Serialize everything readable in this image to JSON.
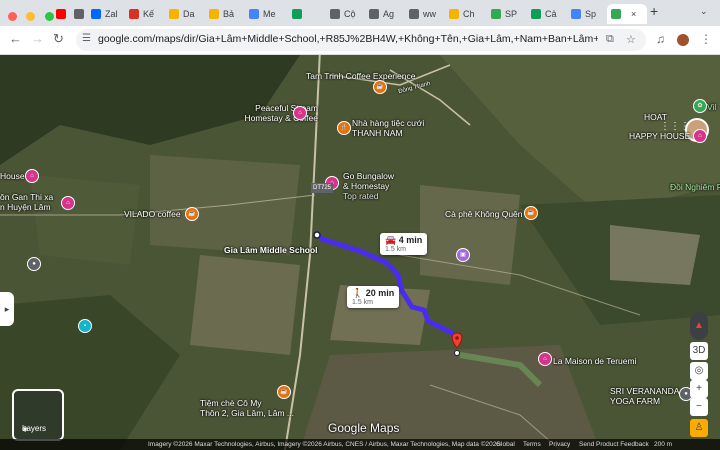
{
  "tabs": [
    {
      "label": "",
      "color": "#ff0000"
    },
    {
      "label": "",
      "color": "#5f6368"
    },
    {
      "label": "Zal",
      "color": "#0068ff"
    },
    {
      "label": "Kế",
      "color": "#d93025"
    },
    {
      "label": "Da",
      "color": "#f4b400"
    },
    {
      "label": "Bả",
      "color": "#f4b400"
    },
    {
      "label": "Me",
      "color": "#4285f4"
    },
    {
      "label": "",
      "color": "#0f9d58"
    },
    {
      "label": "Cộ",
      "color": "#5f6368"
    },
    {
      "label": "Ag",
      "color": "#5f6368"
    },
    {
      "label": "ww",
      "color": "#5f6368"
    },
    {
      "label": "Ch",
      "color": "#f4b400"
    },
    {
      "label": "SP",
      "color": "#34a853"
    },
    {
      "label": "Cả",
      "color": "#0f9d58"
    },
    {
      "label": "Sp",
      "color": "#4285f4"
    },
    {
      "label": "",
      "color": "#34a853"
    }
  ],
  "browser": {
    "url": "google.com/maps/dir/Gia+Lâm+Middle+School,+R85J%2BH4W,+Không+Tên,+Gia+Lâm,+Nam+Ban+Lâm+Hà,+Lâm+Đ...",
    "new_tab": "+",
    "tab_menu": "⌄"
  },
  "map": {
    "places": [
      {
        "name": "Tam Trinh Coffee\nExperience"
      },
      {
        "name": "Peaceful Stream\nHomestay & Coffee"
      },
      {
        "name": "Nhà hàng tiệc cưới\nTHANH NAM"
      },
      {
        "name": "Go Bungalow\n& Homestay"
      },
      {
        "name": "Top rated"
      },
      {
        "name": "VILADO coffee"
      },
      {
        "name": "Gia Lâm Middle School"
      },
      {
        "name": "Cà phê Không Quên"
      },
      {
        "name": "La Maison de Teruemi"
      },
      {
        "name": "SRI VERANANDA\nYOGA FARM"
      },
      {
        "name": "Tiệm chè Cô My\nThôn 2, Gia Lâm, Lâm ..."
      },
      {
        "name": "HOAT"
      },
      {
        "name": "HAPPY HOUSE"
      },
      {
        "name": "Đồi Nghiêm P"
      },
      {
        "name": "House"
      },
      {
        "name": "ôn Gan Thi xa\nn Huyện Lâm"
      },
      {
        "name": "Vil"
      },
      {
        "name": "Đông Thanh"
      },
      {
        "name": "DT725"
      }
    ],
    "route_drive": {
      "time": "4 min",
      "distance": "1.5 km"
    },
    "route_walk": {
      "time": "20 min",
      "distance": "1.5 km"
    },
    "layers_label": "Layers",
    "control_3d": "3D",
    "google_logo": "Google Maps",
    "route_color": "#4a2cf0",
    "destination_color": "#ea4335"
  },
  "footer": {
    "imagery": "Imagery ©2026 Maxar Technologies, Airbus, Imagery ©2026 Airbus, CNES / Airbus, Maxar Technologies, Map data ©2026",
    "global": "Global",
    "terms": "Terms",
    "privacy": "Privacy",
    "feedback": "Send Product Feedback",
    "scale": "200 m"
  }
}
